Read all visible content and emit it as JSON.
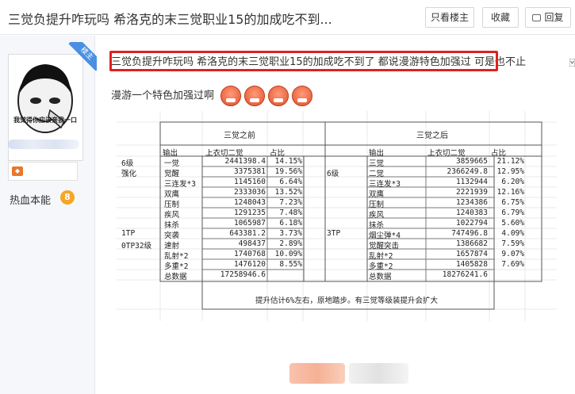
{
  "header": {
    "title": "三觉负提升咋玩吗 希洛克的末三觉职业15的加成吃不到...",
    "only_op_label": "只看楼主",
    "favorite_label": "收藏",
    "reply_label": "回复"
  },
  "user": {
    "ribbon": "楼主",
    "avatar_caption": "我觉得你应该亲我一口",
    "level_title": "热血本能",
    "level": "8"
  },
  "post": {
    "line1_highlighted": "三觉负提升咋玩吗 希洛克的末三觉职业15的加成吃不到了 都说漫游特色加强过",
    "line1_rest": "可是也不止",
    "line2": "漫游一个特色加强过啊"
  },
  "sheet": {
    "left_header": "三觉之前",
    "right_header": "三觉之后",
    "col_output": "输出",
    "col_damage": "上衣切二觉",
    "col_share": "占比",
    "left_side_labels": [
      "6级",
      "强化",
      "1TP",
      "0TP32级"
    ],
    "right_side_labels": [
      "6级",
      "3TP"
    ],
    "left_rows": [
      {
        "skill": "一觉",
        "value": "2441398.4",
        "pct": "14.15%"
      },
      {
        "skill": "觉醒",
        "value": "3375381",
        "pct": "19.56%"
      },
      {
        "skill": "三连发*3",
        "value": "1145160",
        "pct": "6.64%"
      },
      {
        "skill": "双鹰",
        "value": "2333036",
        "pct": "13.52%"
      },
      {
        "skill": "压制",
        "value": "1248043",
        "pct": "7.23%"
      },
      {
        "skill": "疾风",
        "value": "1291235",
        "pct": "7.48%"
      },
      {
        "skill": "抹杀",
        "value": "1065987",
        "pct": "6.18%"
      },
      {
        "skill": "突袭",
        "value": "643381.2",
        "pct": "3.73%"
      },
      {
        "skill": "速射",
        "value": "498437",
        "pct": "2.89%"
      },
      {
        "skill": "乱射*2",
        "value": "1740768",
        "pct": "10.09%"
      },
      {
        "skill": "多重*2",
        "value": "1476120",
        "pct": "8.55%"
      },
      {
        "skill": "总数据",
        "value": "17258946.6",
        "pct": ""
      }
    ],
    "right_rows": [
      {
        "skill": "三觉",
        "value": "3859665",
        "pct": "21.12%"
      },
      {
        "skill": "二觉",
        "value": "2366249.8",
        "pct": "12.95%"
      },
      {
        "skill": "三连发*3",
        "value": "1132944",
        "pct": "6.20%"
      },
      {
        "skill": "双鹰",
        "value": "2221939",
        "pct": "12.16%"
      },
      {
        "skill": "压制",
        "value": "1234386",
        "pct": "6.75%"
      },
      {
        "skill": "疾风",
        "value": "1240383",
        "pct": "6.79%"
      },
      {
        "skill": "抹杀",
        "value": "1022794",
        "pct": "5.60%"
      },
      {
        "skill": "烟尘弹*4",
        "value": "747496.8",
        "pct": "4.09%"
      },
      {
        "skill": "觉醒突击",
        "value": "1386682",
        "pct": "7.59%"
      },
      {
        "skill": "乱射*2",
        "value": "1657874",
        "pct": "9.07%"
      },
      {
        "skill": "多重*2",
        "value": "1405828",
        "pct": "7.69%"
      },
      {
        "skill": "总数据",
        "value": "18276241.6",
        "pct": ""
      }
    ],
    "footer_note": "提升估计6%左右，原地踏步。有三觉等级装提升会扩大"
  },
  "colors": {
    "highlight_border": "#e02020",
    "ribbon": "#4a90e2",
    "level_badge": "#f5a623"
  }
}
